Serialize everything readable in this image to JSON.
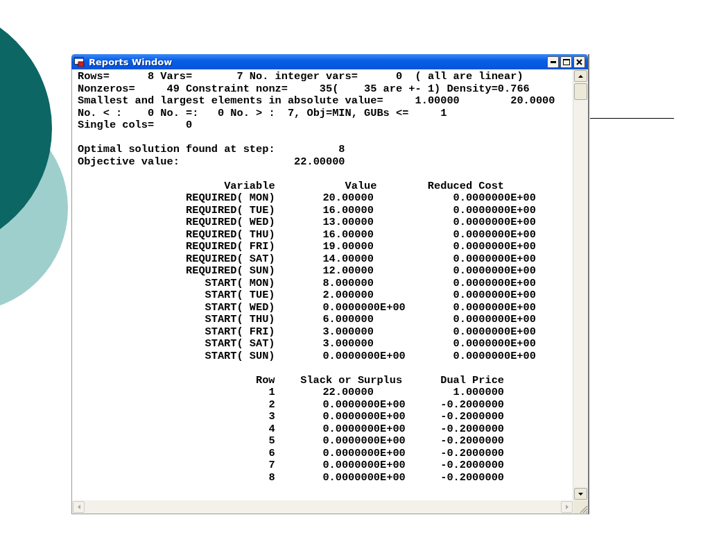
{
  "window": {
    "title": "Reports Window"
  },
  "report": {
    "summary_lines": [
      "Rows=      8 Vars=       7 No. integer vars=      0  ( all are linear)",
      "Nonzeros=     49 Constraint nonz=     35(    35 are +- 1) Density=0.766",
      "Smallest and largest elements in absolute value=     1.00000        20.0000",
      "No. < :    0 No. =:   0 No. > :  7, Obj=MIN, GUBs <=     1",
      "Single cols=     0"
    ],
    "solution": [
      {
        "label": "Optimal solution found at step:",
        "value": "8"
      },
      {
        "label": "Objective value:",
        "value": "22.00000"
      }
    ],
    "variables_table": {
      "columns": [
        "Variable",
        "Value",
        "Reduced Cost"
      ],
      "rows": [
        [
          "REQUIRED( MON)",
          "20.00000",
          "0.0000000E+00"
        ],
        [
          "REQUIRED( TUE)",
          "16.00000",
          "0.0000000E+00"
        ],
        [
          "REQUIRED( WED)",
          "13.00000",
          "0.0000000E+00"
        ],
        [
          "REQUIRED( THU)",
          "16.00000",
          "0.0000000E+00"
        ],
        [
          "REQUIRED( FRI)",
          "19.00000",
          "0.0000000E+00"
        ],
        [
          "REQUIRED( SAT)",
          "14.00000",
          "0.0000000E+00"
        ],
        [
          "REQUIRED( SUN)",
          "12.00000",
          "0.0000000E+00"
        ],
        [
          "START( MON)",
          "8.000000",
          "0.0000000E+00"
        ],
        [
          "START( TUE)",
          "2.000000",
          "0.0000000E+00"
        ],
        [
          "START( WED)",
          "0.0000000E+00",
          "0.0000000E+00"
        ],
        [
          "START( THU)",
          "6.000000",
          "0.0000000E+00"
        ],
        [
          "START( FRI)",
          "3.000000",
          "0.0000000E+00"
        ],
        [
          "START( SAT)",
          "3.000000",
          "0.0000000E+00"
        ],
        [
          "START( SUN)",
          "0.0000000E+00",
          "0.0000000E+00"
        ]
      ]
    },
    "rows_table": {
      "columns": [
        "Row",
        "Slack or Surplus",
        "Dual Price"
      ],
      "rows": [
        [
          "1",
          "22.00000",
          "1.000000"
        ],
        [
          "2",
          "0.0000000E+00",
          "-0.2000000"
        ],
        [
          "3",
          "0.0000000E+00",
          "-0.2000000"
        ],
        [
          "4",
          "0.0000000E+00",
          "-0.2000000"
        ],
        [
          "5",
          "0.0000000E+00",
          "-0.2000000"
        ],
        [
          "6",
          "0.0000000E+00",
          "-0.2000000"
        ],
        [
          "7",
          "0.0000000E+00",
          "-0.2000000"
        ],
        [
          "8",
          "0.0000000E+00",
          "-0.2000000"
        ]
      ]
    }
  }
}
